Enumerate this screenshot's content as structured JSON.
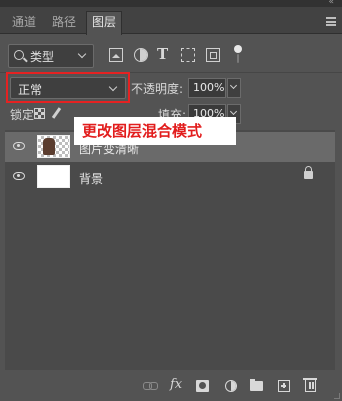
{
  "panel": {
    "collapse_glyph": "«",
    "tabs": [
      {
        "label": "通道",
        "active": false
      },
      {
        "label": "路径",
        "active": false
      },
      {
        "label": "图层",
        "active": true
      }
    ]
  },
  "filter": {
    "kind_label": "类型",
    "icons": [
      "image-filter-icon",
      "adjustment-filter-icon",
      "type-filter-icon",
      "shape-filter-icon",
      "smart-object-filter-icon",
      "filter-toggle-icon"
    ],
    "type_glyph": "T"
  },
  "blend": {
    "mode_value": "正常",
    "opacity_label": "不透明度:",
    "opacity_value": "100%"
  },
  "lock": {
    "label": "锁定:",
    "fill_label": "填充:",
    "fill_value": "100%"
  },
  "annotation": {
    "text": "更改图层混合模式",
    "color": "#e21d1d",
    "highlight_color": "#e52222"
  },
  "layers": [
    {
      "name": "图片变清晰",
      "visible": true,
      "selected": true,
      "thumbnail": "transparent-with-figure",
      "locked": false
    },
    {
      "name": "背景",
      "visible": true,
      "selected": false,
      "thumbnail": "white",
      "locked": true
    }
  ],
  "bottom_bar": {
    "fx_label": "fx",
    "icons": [
      "link-layers-icon",
      "fx-icon",
      "add-mask-icon",
      "new-adjustment-icon",
      "new-group-icon",
      "new-layer-icon",
      "trash-icon"
    ]
  }
}
